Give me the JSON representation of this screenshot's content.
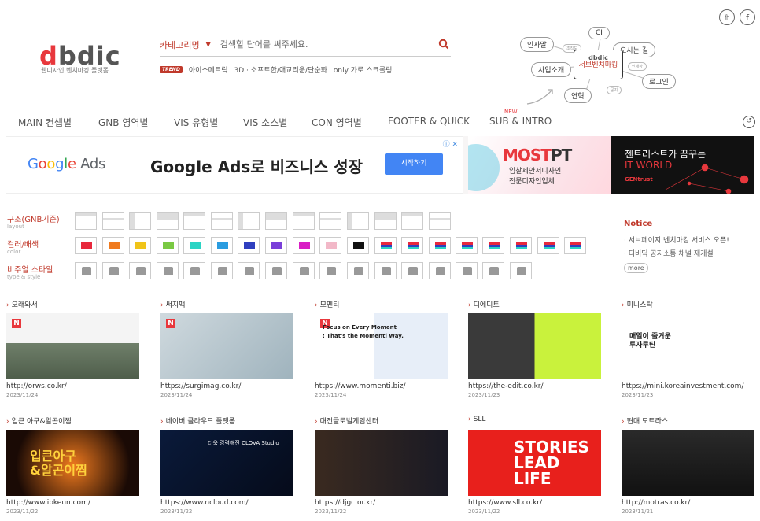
{
  "social": {
    "twitter_icon": "twitter-icon",
    "facebook_icon": "facebook-icon"
  },
  "logo": {
    "text_d1": "d",
    "text_rest": "bdic",
    "subtitle": "웹디자인 벤치마킹 플랫폼"
  },
  "search": {
    "category": "카테고리명",
    "placeholder": "검색할 단어를 써주세요."
  },
  "trend": {
    "badge": "TREND",
    "items": [
      "아이소메트릭",
      "3D · 소프트한/애교리운/단순화",
      "only 가로 스크롤링"
    ]
  },
  "bubbles": {
    "center_top": "dbdic",
    "center_bottom": "서브벤치마킹",
    "items": [
      "인사말",
      "CI",
      "오시는 길",
      "사업소개",
      "로그인",
      "연혁"
    ],
    "mini": [
      "조직도",
      "인재상",
      "공지"
    ]
  },
  "gnb": {
    "items": [
      "MAIN 컨셉별",
      "GNB 영역별",
      "VIS 유형별",
      "VIS 소스별",
      "CON 영역별",
      "FOOTER & QUICK",
      "SUB & INTRO"
    ],
    "new_badge": "NEW"
  },
  "ads": {
    "google_logo": "Google Ads",
    "google_title": "Google Ads로 비즈니스 성장",
    "google_button": "시작하기",
    "mostpt": {
      "brand1": "MOST",
      "brand2": "PT",
      "line1": "입찰제안서디자인",
      "line2": "전문디자인업체"
    },
    "gentrust": {
      "line1": "젠트러스트가 꿈꾸는",
      "line2": "IT WORLD",
      "brand": "GENtrust"
    }
  },
  "filters": {
    "layout": {
      "label": "구조(GNB기준)",
      "sub": "layout"
    },
    "color": {
      "label": "컬러/배색",
      "sub": "color"
    },
    "type": {
      "label": "비주얼 스타일",
      "sub": "type & style"
    },
    "colors": [
      "#e8283c",
      "#f07a1e",
      "#f0c419",
      "#7ac943",
      "#2ad4c4",
      "#2a9ce0",
      "#2f3fbf",
      "#7a3fd9",
      "#d91ec4",
      "#f2b8c8",
      "#111111"
    ]
  },
  "notice": {
    "title": "Notice",
    "items": [
      "서브페이지 벤치마킹 서비스 오픈!",
      "디비딕 공지소통 채널 재개설"
    ],
    "more": "more"
  },
  "cards": [
    {
      "title": "오래와서",
      "url": "http://orws.co.kr/",
      "date": "2023/11/24",
      "badge": "N"
    },
    {
      "title": "써지맥",
      "url": "https://surgimag.co.kr/",
      "date": "2023/11/24",
      "badge": "N"
    },
    {
      "title": "모멘티",
      "url": "https://www.momenti.biz/",
      "date": "2023/11/24",
      "badge": "N",
      "headline1": "Focus on Every Moment",
      "headline2": ": That's the Momenti Way."
    },
    {
      "title": "디에디트",
      "url": "https://the-edit.co.kr/",
      "date": "2023/11/23"
    },
    {
      "title": "미니스탁",
      "url": "https://mini.koreainvestment.com/",
      "date": "2023/11/23",
      "headline1": "매일이 줄거운",
      "headline2": "투자루틴"
    },
    {
      "title": "입큰 아구&알곤이찜",
      "url": "http://www.ibkeun.com/",
      "date": "2023/11/22",
      "headline1": "입큰아구",
      "headline2": "&알곤이찜"
    },
    {
      "title": "네이버 클라우드 플랫폼",
      "url": "https://www.ncloud.com/",
      "date": "2023/11/22",
      "headline1": "더욱 강력해진 CLOVA Studio"
    },
    {
      "title": "대전글로벌게임센터",
      "url": "https://djgc.or.kr/",
      "date": "2023/11/22"
    },
    {
      "title": "SLL",
      "url": "https://www.sll.co.kr/",
      "date": "2023/11/22",
      "headline1": "STORIES",
      "headline2": "LEAD",
      "headline3": "LIFE"
    },
    {
      "title": "현대 모트라스",
      "url": "http://motras.co.kr/",
      "date": "2023/11/21"
    }
  ]
}
